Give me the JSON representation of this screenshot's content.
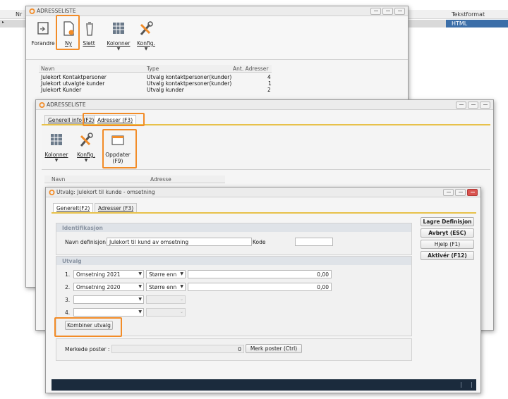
{
  "background_grid": {
    "col_nr": "Nr",
    "col_tekstformat": "Tekstformat",
    "selected_row_tekstformat": "HTML"
  },
  "window_adresseliste_1": {
    "title": "ADRESSELISTE",
    "ribbon": {
      "forandre": "Forandre",
      "ny": "Ny",
      "slett": "Slett",
      "kolonner": "Kolonner",
      "konfig": "Konfig."
    },
    "table": {
      "headers": [
        "Navn",
        "Type",
        "Ant. Adresser"
      ],
      "rows": [
        [
          "Julekort Kontaktpersoner",
          "Utvalg kontaktpersoner(kunder)",
          "4"
        ],
        [
          "Julekort utvalgte kunder",
          "Utvalg kontaktpersoner(kunder)",
          "1"
        ],
        [
          "Julekort Kunder",
          "Utvalg kunder",
          "2"
        ]
      ]
    }
  },
  "window_adresseliste_2": {
    "title": "ADRESSELISTE",
    "tabs": [
      "Generell info (F2)",
      "Adresser (F3)"
    ],
    "ribbon": {
      "kolonner": "Kolonner",
      "konfig": "Konfig.",
      "oppdater": "Oppdater",
      "oppdater_key": "(F9)"
    },
    "table_headers": [
      "Navn",
      "Adresse"
    ]
  },
  "window_utvalg": {
    "title": "Utvalg: Julekort til kunde - omsetning",
    "tabs": [
      "Generelt(F2)",
      "Adresser (F3)"
    ],
    "identifikasjon": {
      "title": "Identifikasjon",
      "navn_label": "Navn definisjon",
      "navn_value": "Julekort til kund av omsetning",
      "kode_label": "Kode",
      "kode_value": ""
    },
    "utvalg": {
      "title": "Utvalg",
      "rows": [
        {
          "num": "1.",
          "field": "Omsetning 2021",
          "op": "Større enn",
          "value": "0,00"
        },
        {
          "num": "2.",
          "field": "Omsetning 2020",
          "op": "Større enn",
          "value": "0,00"
        },
        {
          "num": "3.",
          "field": "",
          "op": "",
          "value": ""
        },
        {
          "num": "4.",
          "field": "",
          "op": "",
          "value": ""
        }
      ],
      "kombiner": "Kombiner utvalg"
    },
    "merkede": {
      "label": "Merkede poster :",
      "value": "0",
      "button": "Merk poster (Ctrl)"
    },
    "side_buttons": {
      "lagre": "Lagre Definisjon",
      "avbryt": "Avbryt (ESC)",
      "hjelp": "Hjelp (F1)",
      "aktiver": "Aktivér (F12)"
    }
  },
  "colors": {
    "highlight": "#f28c28",
    "accent_line": "#e7c14a",
    "selected_row": "#3b6ea8",
    "status_bar": "#1b2b3d"
  }
}
